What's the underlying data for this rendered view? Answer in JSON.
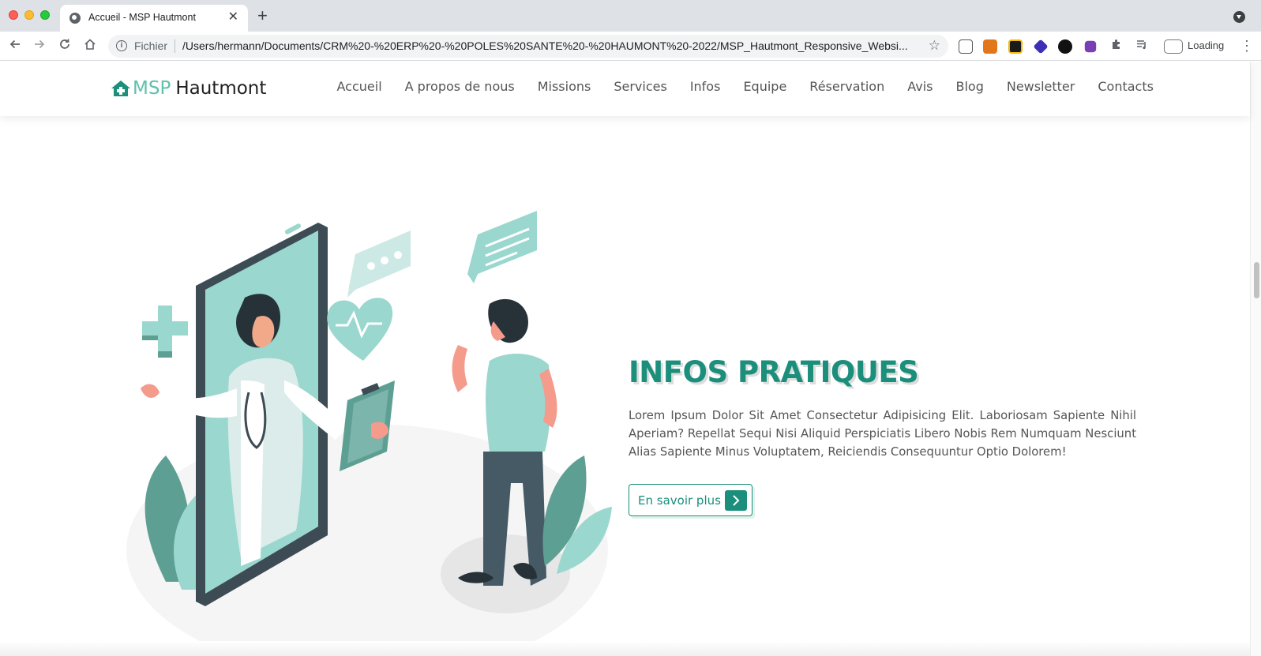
{
  "browser": {
    "tab_title": "Accueil - MSP Hautmont",
    "new_tab_label": "+",
    "close_tab_label": "✕",
    "omnibox_label": "Fichier",
    "url": "/Users/hermann/Documents/CRM%20-%20ERP%20-%20POLES%20SANTE%20-%20HAUMONT%20-2022/MSP_Hautmont_Responsive_Websi...",
    "status_text": "Loading"
  },
  "site": {
    "logo_part1": "MSP",
    "logo_part2": "Hautmont",
    "nav": [
      "Accueil",
      "A propos de nous",
      "Missions",
      "Services",
      "Infos",
      "Equipe",
      "Réservation",
      "Avis",
      "Blog",
      "Newsletter",
      "Contacts"
    ]
  },
  "section": {
    "title": "INFOS PRATIQUES",
    "body": "Lorem Ipsum Dolor Sit Amet Consectetur Adipisicing Elit. Laboriosam Sapiente Nihil Aperiam? Repellat Sequi Nisi Aliquid Perspiciatis Libero Nobis Rem Numquam Nesciunt Alias Sapiente Minus Voluptatem, Reiciendis Consequuntur Optio Dolorem!",
    "cta_label": "En savoir plus"
  },
  "icons": {
    "back": "back-arrow-icon",
    "forward": "forward-arrow-icon",
    "reload": "reload-icon",
    "home": "home-icon",
    "bookmark": "star-icon",
    "extensions": "puzzle-icon",
    "logo": "house-plus-icon",
    "cta": "chevron-right-icon"
  },
  "colors": {
    "brand": "#1b8f7b",
    "brand_light": "#5ec0ad",
    "illustration_mint": "#9ad7cf",
    "phone_dark": "#3d4b54"
  }
}
